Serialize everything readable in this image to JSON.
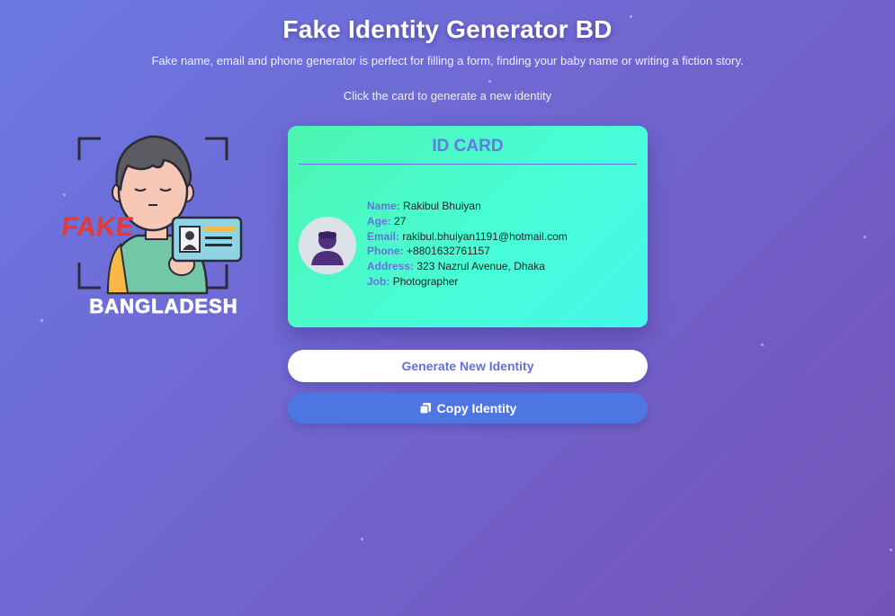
{
  "header": {
    "title": "Fake Identity Generator BD",
    "subtitle": "Fake name, email and phone generator is perfect for filling a form, finding your baby name or writing a fiction story.",
    "hint": "Click the card to generate a new identity"
  },
  "logo": {
    "badge_text": "FAKE",
    "country_text": "BANGLADESH"
  },
  "card": {
    "title": "ID CARD",
    "fields": [
      {
        "label": "Name:",
        "value": "Rakibul Bhuiyan"
      },
      {
        "label": "Age:",
        "value": "27"
      },
      {
        "label": "Email:",
        "value": "rakibul.bhuiyan1191@hotmail.com"
      },
      {
        "label": "Phone:",
        "value": "+8801632761157"
      },
      {
        "label": "Address:",
        "value": "323 Nazrul Avenue, Dhaka"
      },
      {
        "label": "Job:",
        "value": "Photographer"
      }
    ]
  },
  "buttons": {
    "generate_label": "Generate New Identity",
    "copy_label": "Copy Identity",
    "copy_icon": "copy-icon"
  },
  "colors": {
    "background_start": "#6b78e3",
    "background_end": "#7454b8",
    "card_start": "#4cf5b0",
    "card_end": "#44f7ea",
    "accent": "#6b74e8",
    "copy_button": "#4e76e2"
  }
}
